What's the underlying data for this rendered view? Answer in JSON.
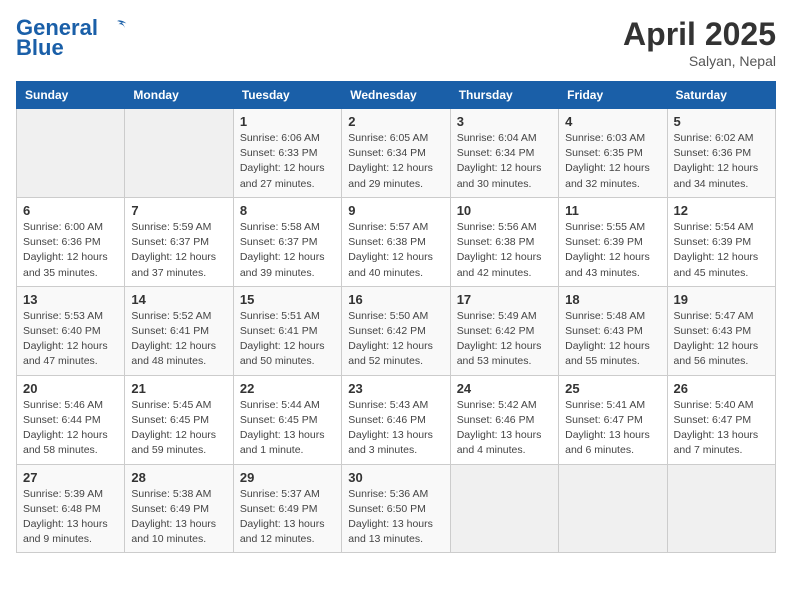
{
  "header": {
    "logo_line1": "General",
    "logo_line2": "Blue",
    "month": "April 2025",
    "location": "Salyan, Nepal"
  },
  "days_of_week": [
    "Sunday",
    "Monday",
    "Tuesday",
    "Wednesday",
    "Thursday",
    "Friday",
    "Saturday"
  ],
  "weeks": [
    [
      {
        "day": "",
        "empty": true
      },
      {
        "day": "",
        "empty": true
      },
      {
        "day": "1",
        "sunrise": "Sunrise: 6:06 AM",
        "sunset": "Sunset: 6:33 PM",
        "daylight": "Daylight: 12 hours and 27 minutes."
      },
      {
        "day": "2",
        "sunrise": "Sunrise: 6:05 AM",
        "sunset": "Sunset: 6:34 PM",
        "daylight": "Daylight: 12 hours and 29 minutes."
      },
      {
        "day": "3",
        "sunrise": "Sunrise: 6:04 AM",
        "sunset": "Sunset: 6:34 PM",
        "daylight": "Daylight: 12 hours and 30 minutes."
      },
      {
        "day": "4",
        "sunrise": "Sunrise: 6:03 AM",
        "sunset": "Sunset: 6:35 PM",
        "daylight": "Daylight: 12 hours and 32 minutes."
      },
      {
        "day": "5",
        "sunrise": "Sunrise: 6:02 AM",
        "sunset": "Sunset: 6:36 PM",
        "daylight": "Daylight: 12 hours and 34 minutes."
      }
    ],
    [
      {
        "day": "6",
        "sunrise": "Sunrise: 6:00 AM",
        "sunset": "Sunset: 6:36 PM",
        "daylight": "Daylight: 12 hours and 35 minutes."
      },
      {
        "day": "7",
        "sunrise": "Sunrise: 5:59 AM",
        "sunset": "Sunset: 6:37 PM",
        "daylight": "Daylight: 12 hours and 37 minutes."
      },
      {
        "day": "8",
        "sunrise": "Sunrise: 5:58 AM",
        "sunset": "Sunset: 6:37 PM",
        "daylight": "Daylight: 12 hours and 39 minutes."
      },
      {
        "day": "9",
        "sunrise": "Sunrise: 5:57 AM",
        "sunset": "Sunset: 6:38 PM",
        "daylight": "Daylight: 12 hours and 40 minutes."
      },
      {
        "day": "10",
        "sunrise": "Sunrise: 5:56 AM",
        "sunset": "Sunset: 6:38 PM",
        "daylight": "Daylight: 12 hours and 42 minutes."
      },
      {
        "day": "11",
        "sunrise": "Sunrise: 5:55 AM",
        "sunset": "Sunset: 6:39 PM",
        "daylight": "Daylight: 12 hours and 43 minutes."
      },
      {
        "day": "12",
        "sunrise": "Sunrise: 5:54 AM",
        "sunset": "Sunset: 6:39 PM",
        "daylight": "Daylight: 12 hours and 45 minutes."
      }
    ],
    [
      {
        "day": "13",
        "sunrise": "Sunrise: 5:53 AM",
        "sunset": "Sunset: 6:40 PM",
        "daylight": "Daylight: 12 hours and 47 minutes."
      },
      {
        "day": "14",
        "sunrise": "Sunrise: 5:52 AM",
        "sunset": "Sunset: 6:41 PM",
        "daylight": "Daylight: 12 hours and 48 minutes."
      },
      {
        "day": "15",
        "sunrise": "Sunrise: 5:51 AM",
        "sunset": "Sunset: 6:41 PM",
        "daylight": "Daylight: 12 hours and 50 minutes."
      },
      {
        "day": "16",
        "sunrise": "Sunrise: 5:50 AM",
        "sunset": "Sunset: 6:42 PM",
        "daylight": "Daylight: 12 hours and 52 minutes."
      },
      {
        "day": "17",
        "sunrise": "Sunrise: 5:49 AM",
        "sunset": "Sunset: 6:42 PM",
        "daylight": "Daylight: 12 hours and 53 minutes."
      },
      {
        "day": "18",
        "sunrise": "Sunrise: 5:48 AM",
        "sunset": "Sunset: 6:43 PM",
        "daylight": "Daylight: 12 hours and 55 minutes."
      },
      {
        "day": "19",
        "sunrise": "Sunrise: 5:47 AM",
        "sunset": "Sunset: 6:43 PM",
        "daylight": "Daylight: 12 hours and 56 minutes."
      }
    ],
    [
      {
        "day": "20",
        "sunrise": "Sunrise: 5:46 AM",
        "sunset": "Sunset: 6:44 PM",
        "daylight": "Daylight: 12 hours and 58 minutes."
      },
      {
        "day": "21",
        "sunrise": "Sunrise: 5:45 AM",
        "sunset": "Sunset: 6:45 PM",
        "daylight": "Daylight: 12 hours and 59 minutes."
      },
      {
        "day": "22",
        "sunrise": "Sunrise: 5:44 AM",
        "sunset": "Sunset: 6:45 PM",
        "daylight": "Daylight: 13 hours and 1 minute."
      },
      {
        "day": "23",
        "sunrise": "Sunrise: 5:43 AM",
        "sunset": "Sunset: 6:46 PM",
        "daylight": "Daylight: 13 hours and 3 minutes."
      },
      {
        "day": "24",
        "sunrise": "Sunrise: 5:42 AM",
        "sunset": "Sunset: 6:46 PM",
        "daylight": "Daylight: 13 hours and 4 minutes."
      },
      {
        "day": "25",
        "sunrise": "Sunrise: 5:41 AM",
        "sunset": "Sunset: 6:47 PM",
        "daylight": "Daylight: 13 hours and 6 minutes."
      },
      {
        "day": "26",
        "sunrise": "Sunrise: 5:40 AM",
        "sunset": "Sunset: 6:47 PM",
        "daylight": "Daylight: 13 hours and 7 minutes."
      }
    ],
    [
      {
        "day": "27",
        "sunrise": "Sunrise: 5:39 AM",
        "sunset": "Sunset: 6:48 PM",
        "daylight": "Daylight: 13 hours and 9 minutes."
      },
      {
        "day": "28",
        "sunrise": "Sunrise: 5:38 AM",
        "sunset": "Sunset: 6:49 PM",
        "daylight": "Daylight: 13 hours and 10 minutes."
      },
      {
        "day": "29",
        "sunrise": "Sunrise: 5:37 AM",
        "sunset": "Sunset: 6:49 PM",
        "daylight": "Daylight: 13 hours and 12 minutes."
      },
      {
        "day": "30",
        "sunrise": "Sunrise: 5:36 AM",
        "sunset": "Sunset: 6:50 PM",
        "daylight": "Daylight: 13 hours and 13 minutes."
      },
      {
        "day": "",
        "empty": true
      },
      {
        "day": "",
        "empty": true
      },
      {
        "day": "",
        "empty": true
      }
    ]
  ]
}
